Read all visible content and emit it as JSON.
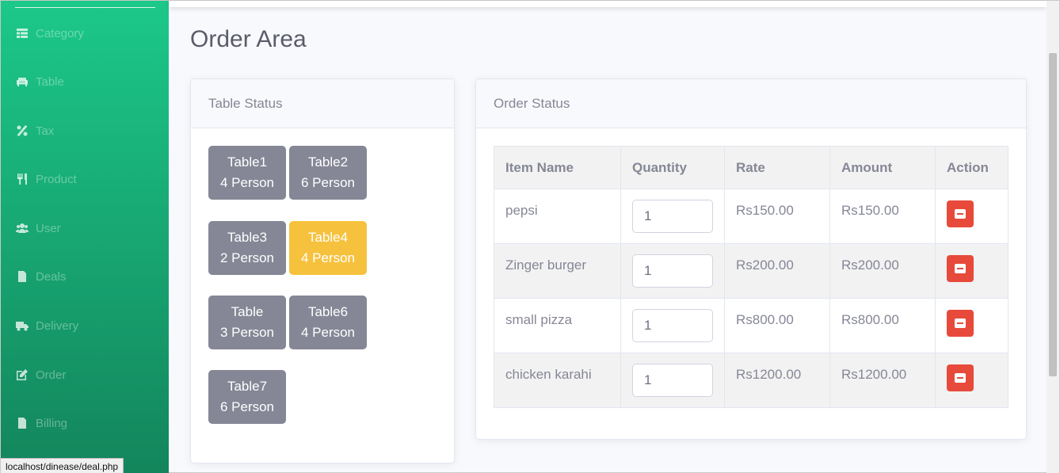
{
  "sidebar": {
    "items": [
      {
        "label": "Category",
        "icon": "table-icon"
      },
      {
        "label": "Table",
        "icon": "couch-icon"
      },
      {
        "label": "Tax",
        "icon": "percent-icon"
      },
      {
        "label": "Product",
        "icon": "utensils-icon"
      },
      {
        "label": "User",
        "icon": "users-icon"
      },
      {
        "label": "Deals",
        "icon": "file-icon"
      },
      {
        "label": "Delivery",
        "icon": "truck-icon"
      },
      {
        "label": "Order",
        "icon": "edit-icon"
      },
      {
        "label": "Billing",
        "icon": "file-text-icon"
      }
    ]
  },
  "status_bar": {
    "url": "localhost/dinease/deal.php"
  },
  "page": {
    "title": "Order Area"
  },
  "table_status": {
    "title": "Table Status",
    "tables": [
      {
        "name": "Table1",
        "capacity": "4 Person",
        "active": false
      },
      {
        "name": "Table2",
        "capacity": "6 Person",
        "active": false
      },
      {
        "name": "Table3",
        "capacity": "2 Person",
        "active": false
      },
      {
        "name": "Table4",
        "capacity": "4 Person",
        "active": true
      },
      {
        "name": "Table",
        "capacity": "3 Person",
        "active": false
      },
      {
        "name": "Table6",
        "capacity": "4 Person",
        "active": false
      },
      {
        "name": "Table7",
        "capacity": "6 Person",
        "active": false
      }
    ]
  },
  "order_status": {
    "title": "Order Status",
    "columns": [
      "Item Name",
      "Quantity",
      "Rate",
      "Amount",
      "Action"
    ],
    "rows": [
      {
        "item": "pepsi",
        "quantity": "1",
        "rate": "Rs150.00",
        "amount": "Rs150.00"
      },
      {
        "item": "Zinger burger",
        "quantity": "1",
        "rate": "Rs200.00",
        "amount": "Rs200.00"
      },
      {
        "item": "small pizza",
        "quantity": "1",
        "rate": "Rs800.00",
        "amount": "Rs800.00"
      },
      {
        "item": "chicken karahi",
        "quantity": "1",
        "rate": "Rs1200.00",
        "amount": "Rs1200.00"
      }
    ]
  },
  "colors": {
    "sidebar_top": "#1cc88a",
    "sidebar_bottom": "#13855c",
    "table_default": "#858796",
    "table_active": "#f6c23e",
    "delete": "#e74a3b"
  }
}
